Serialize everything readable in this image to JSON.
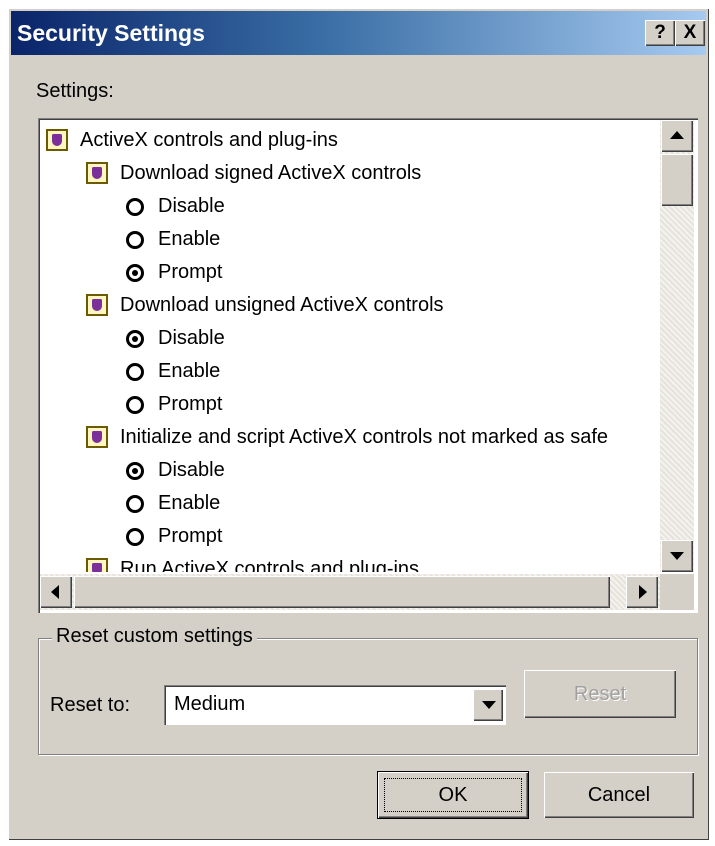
{
  "window": {
    "title": "Security Settings",
    "help_label": "?",
    "close_label": "X"
  },
  "settings_label": "Settings:",
  "tree": {
    "rows": [
      {
        "kind": "category",
        "label": "ActiveX controls and plug-ins",
        "icon": "settings-gear-icon"
      },
      {
        "kind": "setting",
        "label": "Download signed ActiveX controls",
        "icon": "setting-icon"
      },
      {
        "kind": "option",
        "label": "Disable",
        "selected": false
      },
      {
        "kind": "option",
        "label": "Enable",
        "selected": false
      },
      {
        "kind": "option",
        "label": "Prompt",
        "selected": true
      },
      {
        "kind": "setting",
        "label": "Download unsigned ActiveX controls",
        "icon": "setting-icon"
      },
      {
        "kind": "option",
        "label": "Disable",
        "selected": true
      },
      {
        "kind": "option",
        "label": "Enable",
        "selected": false
      },
      {
        "kind": "option",
        "label": "Prompt",
        "selected": false
      },
      {
        "kind": "setting",
        "label": "Initialize and script ActiveX controls not marked as safe",
        "icon": "setting-icon"
      },
      {
        "kind": "option",
        "label": "Disable",
        "selected": true
      },
      {
        "kind": "option",
        "label": "Enable",
        "selected": false
      },
      {
        "kind": "option",
        "label": "Prompt",
        "selected": false
      },
      {
        "kind": "setting",
        "label": "Run ActiveX controls and plug-ins",
        "icon": "setting-icon"
      }
    ]
  },
  "reset_group": {
    "legend": "Reset custom settings",
    "reset_to_label": "Reset to:",
    "reset_to_value": "Medium",
    "reset_button": "Reset"
  },
  "buttons": {
    "ok": "OK",
    "cancel": "Cancel"
  },
  "colors": {
    "titlebar_start": "#0a246a",
    "titlebar_end": "#a6caf0",
    "face": "#d4d0c8"
  }
}
